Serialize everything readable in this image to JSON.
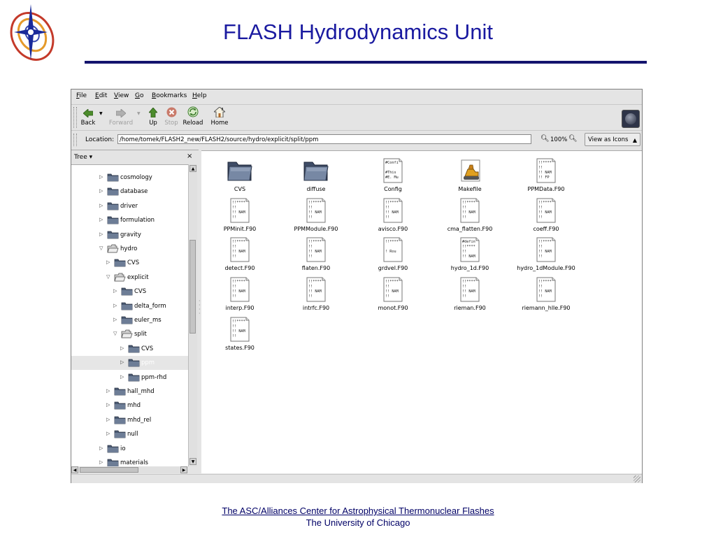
{
  "slide": {
    "title": "FLASH Hydrodynamics Unit",
    "footer_line1": "The ASC/Alliances Center for Astrophysical Thermonuclear Flashes",
    "footer_line2": "The University of Chicago",
    "title_color": "#1a1aa0",
    "rule_color": "#14146e"
  },
  "menu": [
    {
      "key": "F",
      "rest": "ile"
    },
    {
      "key": "E",
      "rest": "dit"
    },
    {
      "key": "V",
      "rest": "iew"
    },
    {
      "key": "G",
      "rest": "o"
    },
    {
      "key": "B",
      "rest": "ookmarks"
    },
    {
      "key": "H",
      "rest": "elp"
    }
  ],
  "toolbar": {
    "back": "Back",
    "forward": "Forward",
    "up": "Up",
    "stop": "Stop",
    "reload": "Reload",
    "home": "Home"
  },
  "location": {
    "label": "Location:",
    "path": "/home/tomek/FLASH2_new/FLASH2/source/hydro/explicit/split/ppm",
    "zoom": "100%",
    "view_mode": "View as Icons"
  },
  "sidebar": {
    "title": "Tree",
    "close": "×",
    "items": [
      {
        "label": "cosmology",
        "depth": 0,
        "expanded": false
      },
      {
        "label": "database",
        "depth": 0,
        "expanded": false
      },
      {
        "label": "driver",
        "depth": 0,
        "expanded": false
      },
      {
        "label": "formulation",
        "depth": 0,
        "expanded": false
      },
      {
        "label": "gravity",
        "depth": 0,
        "expanded": false
      },
      {
        "label": "hydro",
        "depth": 0,
        "expanded": true
      },
      {
        "label": "CVS",
        "depth": 1,
        "expanded": false
      },
      {
        "label": "explicit",
        "depth": 1,
        "expanded": true
      },
      {
        "label": "CVS",
        "depth": 2,
        "expanded": false
      },
      {
        "label": "delta_form",
        "depth": 2,
        "expanded": false
      },
      {
        "label": "euler_ms",
        "depth": 2,
        "expanded": false
      },
      {
        "label": "split",
        "depth": 2,
        "expanded": true
      },
      {
        "label": "CVS",
        "depth": 3,
        "expanded": false
      },
      {
        "label": "ppm",
        "depth": 3,
        "expanded": false,
        "selected": true
      },
      {
        "label": "ppm-rhd",
        "depth": 3,
        "expanded": false
      },
      {
        "label": "hall_mhd",
        "depth": 1,
        "expanded": false
      },
      {
        "label": "mhd",
        "depth": 1,
        "expanded": false
      },
      {
        "label": "mhd_rel",
        "depth": 1,
        "expanded": false
      },
      {
        "label": "null",
        "depth": 1,
        "expanded": false
      },
      {
        "label": "io",
        "depth": 0,
        "expanded": false
      },
      {
        "label": "materials",
        "depth": 0,
        "expanded": false
      }
    ]
  },
  "files": [
    {
      "name": "CVS",
      "kind": "folder"
    },
    {
      "name": "diffuse",
      "kind": "folder"
    },
    {
      "name": "Config",
      "kind": "text",
      "preview": [
        "#Confi",
        "",
        "#This",
        "#E. Mu"
      ]
    },
    {
      "name": "Makefile",
      "kind": "makefile"
    },
    {
      "name": "PPMData.F90",
      "kind": "text",
      "preview": [
        "!!****",
        "!!",
        "!! NAM",
        "!! FP"
      ]
    },
    {
      "name": "PPMinit.F90",
      "kind": "text",
      "preview": [
        "!!****",
        "!!",
        "!! NAM",
        "!!"
      ]
    },
    {
      "name": "PPMModule.F90",
      "kind": "text",
      "preview": [
        "!!****",
        "!!",
        "!! NAM",
        "!!"
      ]
    },
    {
      "name": "avisco.F90",
      "kind": "text",
      "preview": [
        "!!****",
        "!!",
        "!! NAM",
        "!!"
      ]
    },
    {
      "name": "cma_flatten.F90",
      "kind": "text",
      "preview": [
        "!!****",
        "!!",
        "!! NAM",
        "!!"
      ]
    },
    {
      "name": "coeff.F90",
      "kind": "text",
      "preview": [
        "!!****",
        "!!",
        "!! NAM",
        "!!"
      ]
    },
    {
      "name": "detect.F90",
      "kind": "text",
      "preview": [
        "!!****",
        "!!",
        "!! NAM",
        "!!"
      ]
    },
    {
      "name": "flaten.F90",
      "kind": "text",
      "preview": [
        "!!****",
        "!!",
        "!! NAM",
        "!!"
      ]
    },
    {
      "name": "grdvel.F90",
      "kind": "text",
      "preview": [
        "!!****",
        "",
        "! Rou",
        ""
      ]
    },
    {
      "name": "hydro_1d.F90",
      "kind": "text",
      "preview": [
        "#defin",
        "!!****",
        "!!",
        "!! NAM"
      ]
    },
    {
      "name": "hydro_1dModule.F90",
      "kind": "text",
      "preview": [
        "!!****",
        "!!",
        "!! NAM",
        "!!"
      ]
    },
    {
      "name": "interp.F90",
      "kind": "text",
      "preview": [
        "!!****",
        "!!",
        "!! NAM",
        "!!"
      ]
    },
    {
      "name": "intrfc.F90",
      "kind": "text",
      "preview": [
        "!!****",
        "!!",
        "!! NAM",
        "!!"
      ]
    },
    {
      "name": "monot.F90",
      "kind": "text",
      "preview": [
        "!!****",
        "!!",
        "!! NAM",
        "!!"
      ]
    },
    {
      "name": "rieman.F90",
      "kind": "text",
      "preview": [
        "!!****",
        "!!",
        "!! NAM",
        "!!"
      ]
    },
    {
      "name": "riemann_hlle.F90",
      "kind": "text",
      "preview": [
        "!!****",
        "!!",
        "!! NAM",
        "!!"
      ]
    },
    {
      "name": "states.F90",
      "kind": "text",
      "preview": [
        "!!****",
        "!!",
        "!! NAM",
        "!!"
      ]
    }
  ]
}
